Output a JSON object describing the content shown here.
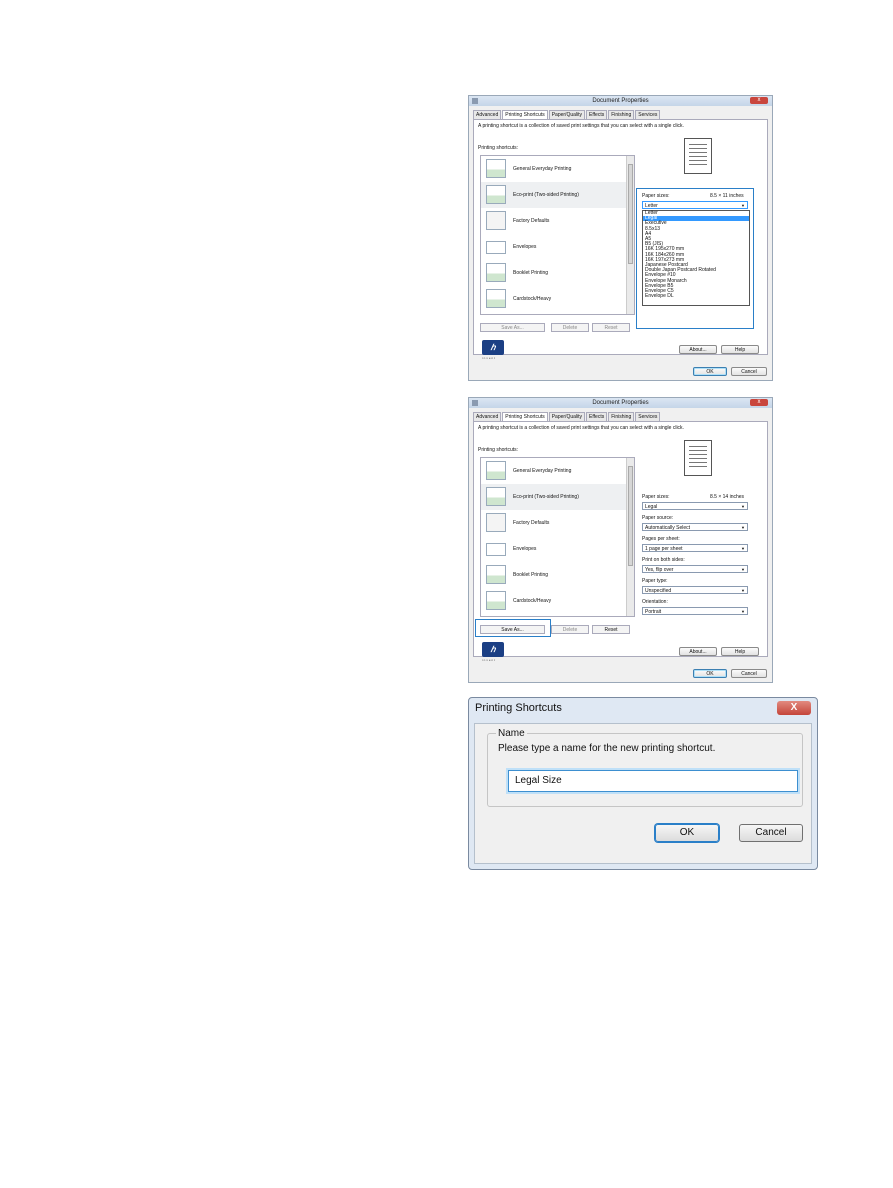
{
  "dialog1": {
    "title": "Document Properties",
    "tabs": [
      "Advanced",
      "Printing Shortcuts",
      "Paper/Quality",
      "Effects",
      "Finishing",
      "Services"
    ],
    "description": "A printing shortcut is a collection of saved print settings that you can select with a single click.",
    "shortcuts_label": "Printing shortcuts:",
    "shortcuts": [
      "General Everyday Printing",
      "Eco-print (Two-sided Printing)",
      "Factory Defaults",
      "Envelopes",
      "Booklet Printing",
      "Cardstock/Heavy"
    ],
    "buttons": {
      "save_as": "Save As...",
      "delete": "Delete",
      "reset": "Reset",
      "about": "About...",
      "help": "Help",
      "ok": "OK",
      "cancel": "Cancel"
    },
    "paper_sizes_label": "Paper sizes:",
    "paper_sizes_value_text": "8.5 × 11 inches",
    "paper_size_selected": "Letter",
    "paper_size_options": [
      "Letter",
      "Legal",
      "Executive",
      "8.5x13",
      "A4",
      "A5",
      "B5 (JIS)",
      "16K 195x270 mm",
      "16K 184x260 mm",
      "16K 197x273 mm",
      "Japanese Postcard",
      "Double Japan Postcard Rotated",
      "Envelope #10",
      "Envelope Monarch",
      "Envelope B5",
      "Envelope C5",
      "Envelope DL"
    ],
    "highlighted_option": "Legal"
  },
  "dialog2": {
    "title": "Document Properties",
    "tabs": [
      "Advanced",
      "Printing Shortcuts",
      "Paper/Quality",
      "Effects",
      "Finishing",
      "Services"
    ],
    "description": "A printing shortcut is a collection of saved print settings that you can select with a single click.",
    "shortcuts_label": "Printing shortcuts:",
    "shortcuts": [
      "General Everyday Printing",
      "Eco-print (Two-sided Printing)",
      "Factory Defaults",
      "Envelopes",
      "Booklet Printing",
      "Cardstock/Heavy"
    ],
    "buttons": {
      "save_as": "Save As...",
      "delete": "Delete",
      "reset": "Reset",
      "about": "About...",
      "help": "Help",
      "ok": "OK",
      "cancel": "Cancel"
    },
    "paper_sizes_label": "Paper sizes:",
    "paper_sizes_value_text": "8.5 × 14 inches",
    "settings": [
      {
        "label": "Paper sizes:",
        "value": "Legal"
      },
      {
        "label": "Paper source:",
        "value": "Automatically Select"
      },
      {
        "label": "Pages per sheet:",
        "value": "1 page per sheet"
      },
      {
        "label": "Print on both sides:",
        "value": "Yes, flip over"
      },
      {
        "label": "Paper type:",
        "value": "Unspecified"
      },
      {
        "label": "Orientation:",
        "value": "Portrait"
      }
    ]
  },
  "dialog3": {
    "title": "Printing Shortcuts",
    "close_glyph": "X",
    "group_label": "Name",
    "group_desc": "Please type a name for the new printing shortcut.",
    "input_value": "Legal Size",
    "ok": "OK",
    "cancel": "Cancel"
  },
  "colors": {
    "highlight": "#2a7fc8",
    "hp_logo": "#1b3f84"
  }
}
